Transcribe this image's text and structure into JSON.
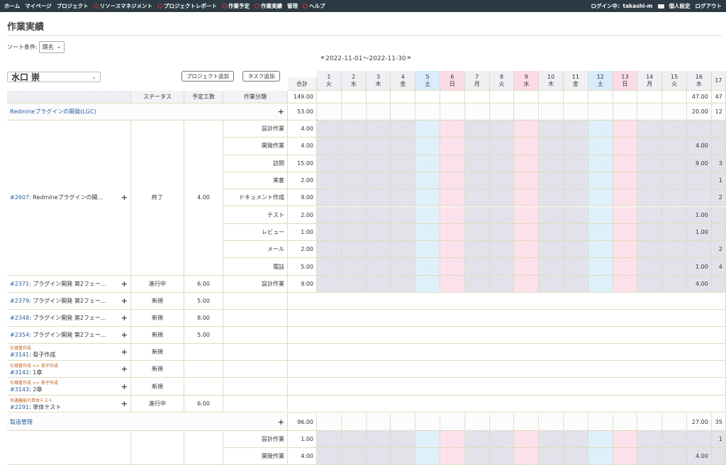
{
  "topbar": {
    "nav": [
      "ホーム",
      "マイページ",
      "プロジェクト",
      "リソースマネジメント",
      "プロジェクトレポート",
      "作業予定",
      "作業実績",
      "管理",
      "ヘルプ"
    ],
    "login_label": "ログイン中：",
    "login_user": "takashi-m",
    "personal_settings": "個人設定",
    "logout": "ログアウト"
  },
  "page": {
    "title": "作業実績",
    "sort_label": "ソート条件:",
    "sort_value": "題名",
    "period": "2022-11-01〜2022-11-30",
    "prev": "«",
    "next": "»",
    "user": "水口 崇",
    "add_project": "プロジェクト追加",
    "add_task": "タスク追加"
  },
  "table": {
    "headers": {
      "status": "ステータス",
      "planned": "予定工数",
      "category": "作業分類",
      "total": "合計"
    },
    "header_total": "149.00",
    "header_days": {
      "16": "47.00",
      "17": "47"
    },
    "days": [
      {
        "d": "1",
        "w": "火",
        "t": "w"
      },
      {
        "d": "2",
        "w": "水",
        "t": "w"
      },
      {
        "d": "3",
        "w": "木",
        "t": "w"
      },
      {
        "d": "4",
        "w": "金",
        "t": "w"
      },
      {
        "d": "5",
        "w": "土",
        "t": "sat"
      },
      {
        "d": "6",
        "w": "日",
        "t": "sun"
      },
      {
        "d": "7",
        "w": "月",
        "t": "w"
      },
      {
        "d": "8",
        "w": "火",
        "t": "w"
      },
      {
        "d": "9",
        "w": "水",
        "t": "sun"
      },
      {
        "d": "10",
        "w": "木",
        "t": "w"
      },
      {
        "d": "11",
        "w": "金",
        "t": "w"
      },
      {
        "d": "12",
        "w": "土",
        "t": "sat"
      },
      {
        "d": "13",
        "w": "日",
        "t": "sun"
      },
      {
        "d": "14",
        "w": "月",
        "t": "w"
      },
      {
        "d": "15",
        "w": "火",
        "t": "w"
      },
      {
        "d": "16",
        "w": "水",
        "t": "w"
      },
      {
        "d": "17",
        "w": "",
        "t": "w"
      }
    ],
    "projects": [
      {
        "name": "Redmineプラグインの開発(LGC)",
        "total": "53.00",
        "d16": "20.00",
        "d17": "12",
        "main_task": {
          "id": "#2607",
          "title": ": Redmineプラグインの開...",
          "status": "終了",
          "planned": "4.00",
          "rows": [
            {
              "cat": "設計作業",
              "total": "4.00",
              "d16": "",
              "d17": ""
            },
            {
              "cat": "開発作業",
              "total": "4.00",
              "d16": "4.00",
              "d17": ""
            },
            {
              "cat": "訪問",
              "total": "15.00",
              "d16": "9.00",
              "d17": "3"
            },
            {
              "cat": "来客",
              "total": "2.00",
              "d16": "",
              "d17": "1"
            },
            {
              "cat": "ドキュメント作成",
              "total": "9.00",
              "d16": "",
              "d17": "2"
            },
            {
              "cat": "テスト",
              "total": "2.00",
              "d16": "1.00",
              "d17": ""
            },
            {
              "cat": "レビュー",
              "total": "1.00",
              "d16": "1.00",
              "d17": ""
            },
            {
              "cat": "メール",
              "total": "2.00",
              "d16": "",
              "d17": "2"
            },
            {
              "cat": "電話",
              "total": "5.00",
              "d16": "1.00",
              "d17": "4"
            }
          ]
        },
        "task2371": {
          "id": "#2371",
          "title": ": プラグイン開発 第2フェー...",
          "status": "進行中",
          "planned": "6.00",
          "cat": "設計作業",
          "total": "9.00",
          "d16": "4.00"
        },
        "tasks": [
          {
            "id": "#2379",
            "title": ": プラグイン開発 第2フェー...",
            "status": "新規",
            "planned": "5.00"
          },
          {
            "id": "#2348",
            "title": ": プラグイン開発 第2フェー...",
            "status": "新規",
            "planned": "8.00"
          },
          {
            "id": "#2354",
            "title": ": プラグイン開発 第2フェー...",
            "status": "新規",
            "planned": "5.00"
          }
        ],
        "tagged_tasks": [
          {
            "tag": "仕様書作成",
            "id": "#3141",
            "title": ": 骨子作成",
            "status": "新規",
            "planned": ""
          },
          {
            "tag": "仕様書作成 >> 骨子作成",
            "id": "#3142",
            "title": ": 1章",
            "status": "新規",
            "planned": ""
          },
          {
            "tag": "仕様書作成 >> 骨子作成",
            "id": "#3143",
            "title": ": 2章",
            "status": "新規",
            "planned": ""
          },
          {
            "tag": "共通機能の単体テスト",
            "id": "#2291",
            "title": ": 単体テスト",
            "status": "進行中",
            "planned": "6.00"
          }
        ]
      },
      {
        "name": "製造管理",
        "total": "96.00",
        "d16": "27.00",
        "d17": "35",
        "rows": [
          {
            "cat": "設計作業",
            "total": "1.00",
            "d16": "",
            "d17": "1"
          },
          {
            "cat": "開発作業",
            "total": "4.00",
            "d16": "4.00",
            "d17": ""
          }
        ]
      }
    ]
  }
}
